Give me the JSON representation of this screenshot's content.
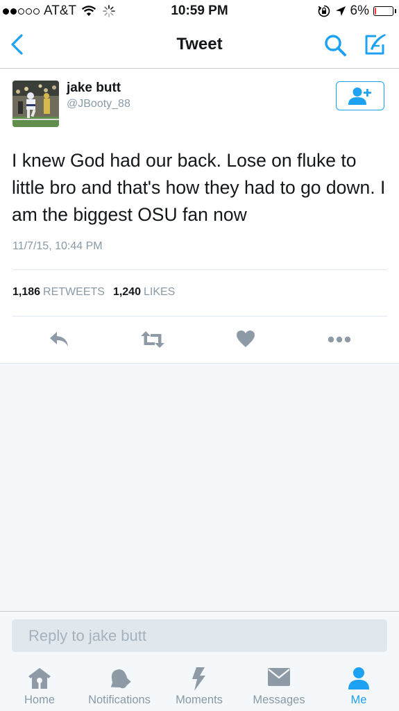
{
  "status_bar": {
    "carrier": "AT&T",
    "time": "10:59 PM",
    "battery": "6%",
    "battery_level": 0.06
  },
  "nav": {
    "title": "Tweet"
  },
  "tweet": {
    "author_name": "jake butt",
    "author_handle": "@JBooty_88",
    "text": "I knew God had our back. Lose on fluke to little bro and that's how they had to go down. I am the biggest OSU fan now",
    "timestamp": "11/7/15, 10:44 PM",
    "retweets_count": "1,186",
    "retweets_label": "RETWEETS",
    "likes_count": "1,240",
    "likes_label": "LIKES"
  },
  "reply": {
    "placeholder": "Reply to jake butt"
  },
  "tabs": [
    {
      "label": "Home",
      "icon": "home-icon"
    },
    {
      "label": "Notifications",
      "icon": "bell-icon"
    },
    {
      "label": "Moments",
      "icon": "lightning-icon"
    },
    {
      "label": "Messages",
      "icon": "envelope-icon"
    },
    {
      "label": "Me",
      "icon": "person-icon"
    }
  ],
  "colors": {
    "accent": "#1da1f2",
    "muted": "#8899a6",
    "icon_gray": "#8e9ba7",
    "battery_low": "#ff3b30"
  }
}
